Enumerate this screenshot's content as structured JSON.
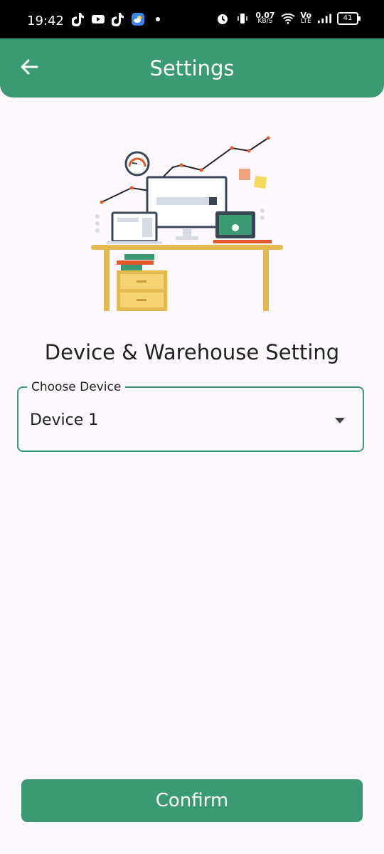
{
  "status_bar": {
    "time": "19:42",
    "net_speed_value": "0.07",
    "net_speed_unit": "KB/S",
    "volte_label": "Vo",
    "lte_label": "LTE",
    "battery": "41",
    "icons_left": [
      "tiktok-icon",
      "youtube-icon",
      "tiktok-icon",
      "weather-icon",
      "dot-icon"
    ],
    "icons_right": [
      "alarm-icon",
      "vibrate-icon",
      "wifi-icon",
      "signal-icon",
      "battery-icon"
    ]
  },
  "app_bar": {
    "title": "Settings",
    "back_icon": "arrow-left-icon"
  },
  "main": {
    "section_title": "Device & Warehouse Setting",
    "device_select": {
      "label": "Choose Device",
      "value": "Device 1"
    },
    "confirm_label": "Confirm"
  },
  "colors": {
    "primary": "#3a9a74",
    "background": "#fdf8fc",
    "text": "#222222"
  }
}
